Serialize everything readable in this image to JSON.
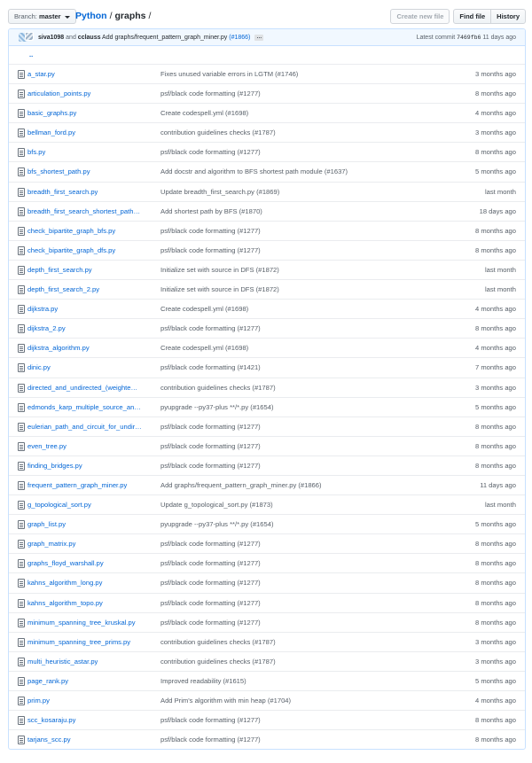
{
  "branch": {
    "label": "Branch:",
    "name": "master"
  },
  "breadcrumb": {
    "repo": "Python",
    "separator": "/",
    "folder": "graphs",
    "trailing": "/"
  },
  "actions": {
    "create": "Create new file",
    "find": "Find file",
    "history": "History"
  },
  "commit": {
    "author1": "siva1098",
    "and": "and",
    "author2": "cclauss",
    "message": "Add graphs/frequent_pattern_graph_miner.py",
    "pr": "(#1866)",
    "ellipsis": "…",
    "latest_label": "Latest commit",
    "sha": "7469fb6",
    "age": "11 days ago"
  },
  "parent": "..",
  "files": [
    {
      "name": "a_star.py",
      "message": "Fixes unused variable errors in LGTM (#1746)",
      "age": "3 months ago"
    },
    {
      "name": "articulation_points.py",
      "message": "psf/black code formatting (#1277)",
      "age": "8 months ago"
    },
    {
      "name": "basic_graphs.py",
      "message": "Create codespell.yml (#1698)",
      "age": "4 months ago"
    },
    {
      "name": "bellman_ford.py",
      "message": "contribution guidelines checks (#1787)",
      "age": "3 months ago"
    },
    {
      "name": "bfs.py",
      "message": "psf/black code formatting (#1277)",
      "age": "8 months ago"
    },
    {
      "name": "bfs_shortest_path.py",
      "message": "Add docstr and algorithm to BFS shortest path module (#1637)",
      "age": "5 months ago"
    },
    {
      "name": "breadth_first_search.py",
      "message": "Update breadth_first_search.py (#1869)",
      "age": "last month"
    },
    {
      "name": "breadth_first_search_shortest_path…",
      "message": "Add shortest path by BFS (#1870)",
      "age": "18 days ago"
    },
    {
      "name": "check_bipartite_graph_bfs.py",
      "message": "psf/black code formatting (#1277)",
      "age": "8 months ago"
    },
    {
      "name": "check_bipartite_graph_dfs.py",
      "message": "psf/black code formatting (#1277)",
      "age": "8 months ago"
    },
    {
      "name": "depth_first_search.py",
      "message": "Initialize set with source in DFS (#1872)",
      "age": "last month"
    },
    {
      "name": "depth_first_search_2.py",
      "message": "Initialize set with source in DFS (#1872)",
      "age": "last month"
    },
    {
      "name": "dijkstra.py",
      "message": "Create codespell.yml (#1698)",
      "age": "4 months ago"
    },
    {
      "name": "dijkstra_2.py",
      "message": "psf/black code formatting (#1277)",
      "age": "8 months ago"
    },
    {
      "name": "dijkstra_algorithm.py",
      "message": "Create codespell.yml (#1698)",
      "age": "4 months ago"
    },
    {
      "name": "dinic.py",
      "message": "psf/black code formatting (#1421)",
      "age": "7 months ago"
    },
    {
      "name": "directed_and_undirected_(weighte…",
      "message": "contribution guidelines checks (#1787)",
      "age": "3 months ago"
    },
    {
      "name": "edmonds_karp_multiple_source_an…",
      "message": "pyupgrade --py37-plus **/*.py (#1654)",
      "age": "5 months ago"
    },
    {
      "name": "eulerian_path_and_circuit_for_undir…",
      "message": "psf/black code formatting (#1277)",
      "age": "8 months ago"
    },
    {
      "name": "even_tree.py",
      "message": "psf/black code formatting (#1277)",
      "age": "8 months ago"
    },
    {
      "name": "finding_bridges.py",
      "message": "psf/black code formatting (#1277)",
      "age": "8 months ago"
    },
    {
      "name": "frequent_pattern_graph_miner.py",
      "message": "Add graphs/frequent_pattern_graph_miner.py (#1866)",
      "age": "11 days ago"
    },
    {
      "name": "g_topological_sort.py",
      "message": "Update g_topological_sort.py (#1873)",
      "age": "last month"
    },
    {
      "name": "graph_list.py",
      "message": "pyupgrade --py37-plus **/*.py (#1654)",
      "age": "5 months ago"
    },
    {
      "name": "graph_matrix.py",
      "message": "psf/black code formatting (#1277)",
      "age": "8 months ago"
    },
    {
      "name": "graphs_floyd_warshall.py",
      "message": "psf/black code formatting (#1277)",
      "age": "8 months ago"
    },
    {
      "name": "kahns_algorithm_long.py",
      "message": "psf/black code formatting (#1277)",
      "age": "8 months ago"
    },
    {
      "name": "kahns_algorithm_topo.py",
      "message": "psf/black code formatting (#1277)",
      "age": "8 months ago"
    },
    {
      "name": "minimum_spanning_tree_kruskal.py",
      "message": "psf/black code formatting (#1277)",
      "age": "8 months ago"
    },
    {
      "name": "minimum_spanning_tree_prims.py",
      "message": "contribution guidelines checks (#1787)",
      "age": "3 months ago"
    },
    {
      "name": "multi_heuristic_astar.py",
      "message": "contribution guidelines checks (#1787)",
      "age": "3 months ago"
    },
    {
      "name": "page_rank.py",
      "message": "Improved readability (#1615)",
      "age": "5 months ago"
    },
    {
      "name": "prim.py",
      "message": "Add Prim's algorithm with min heap (#1704)",
      "age": "4 months ago"
    },
    {
      "name": "scc_kosaraju.py",
      "message": "psf/black code formatting (#1277)",
      "age": "8 months ago"
    },
    {
      "name": "tarjans_scc.py",
      "message": "psf/black code formatting (#1277)",
      "age": "8 months ago"
    }
  ]
}
